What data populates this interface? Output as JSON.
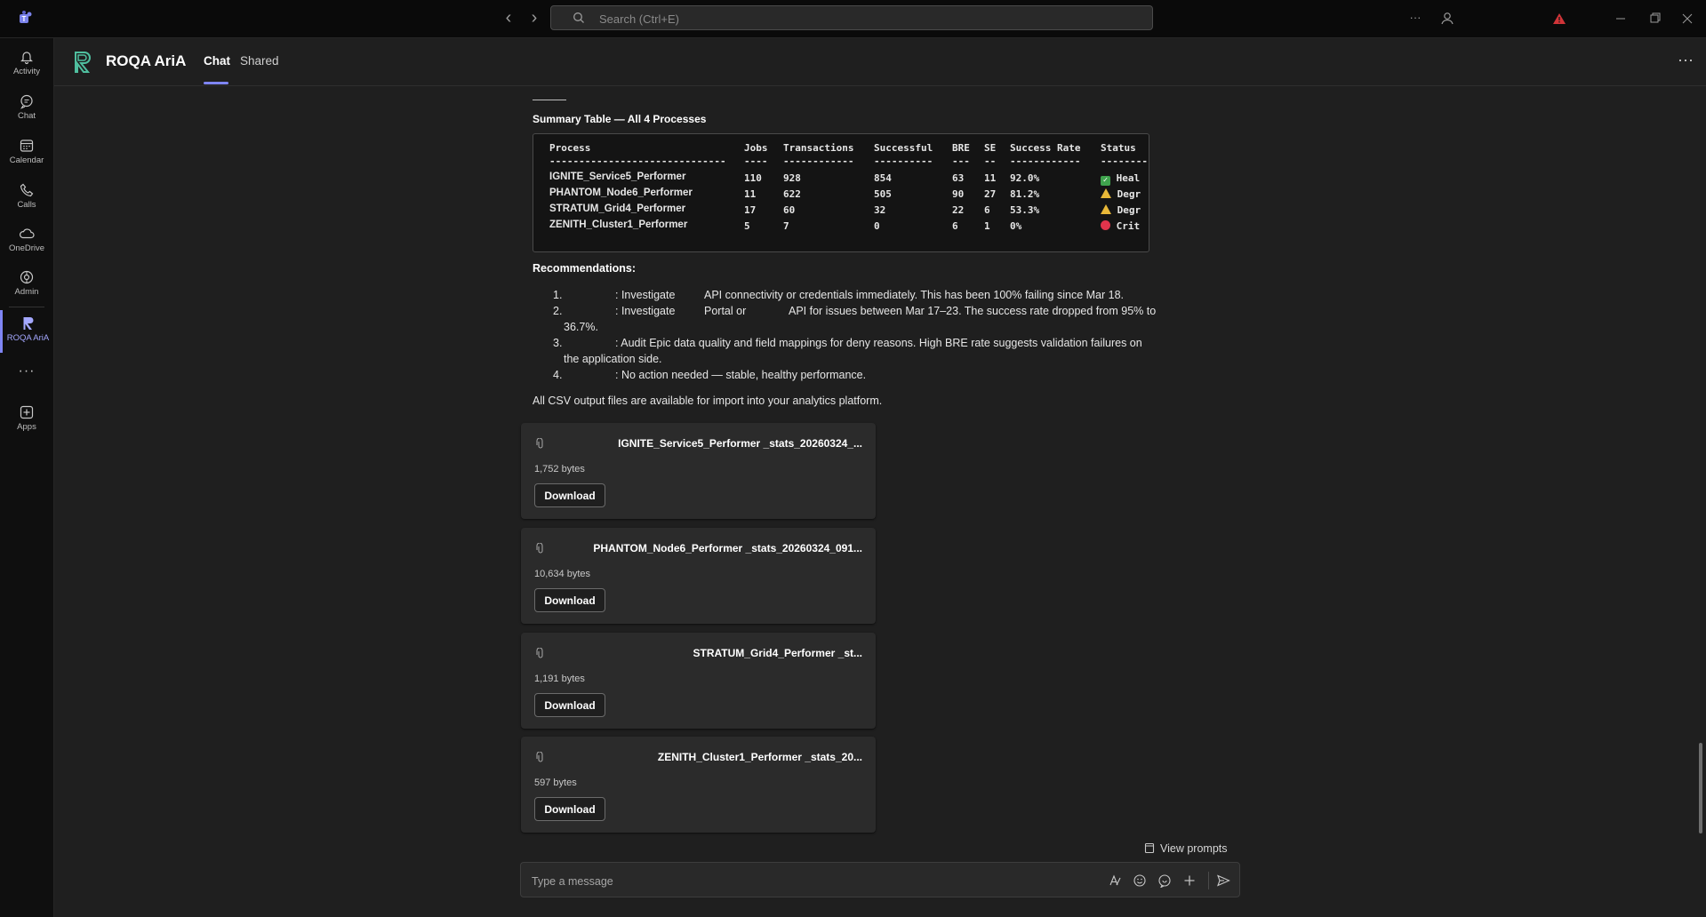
{
  "titlebar": {
    "search_placeholder": "Search (Ctrl+E)",
    "icons": [
      "teams-logo-icon",
      "back-arrow-icon",
      "forward-arrow-icon",
      "search-icon",
      "more-icon",
      "profile-icon",
      "warning-icon",
      "minimize-icon",
      "maximize-icon",
      "close-icon"
    ]
  },
  "rail": {
    "items": [
      {
        "label": "Activity",
        "icon": "bell-icon"
      },
      {
        "label": "Chat",
        "icon": "chat-icon"
      },
      {
        "label": "Calendar",
        "icon": "calendar-icon"
      },
      {
        "label": "Calls",
        "icon": "phone-icon"
      },
      {
        "label": "OneDrive",
        "icon": "cloud-icon"
      },
      {
        "label": "Admin",
        "icon": "admin-icon"
      },
      {
        "label": "ROQA AriA",
        "icon": "roqa-icon",
        "active": true
      },
      {
        "label": "Apps",
        "icon": "add-app-icon"
      }
    ],
    "accent": "#7f85f5"
  },
  "header": {
    "app_name": "ROQA AriA",
    "tabs": [
      {
        "label": "Chat",
        "active": true
      },
      {
        "label": "Shared",
        "active": false
      }
    ]
  },
  "message": {
    "summary_title": "Summary Table — All 4 Processes",
    "table": {
      "headers": [
        "Process",
        "Jobs",
        "Transactions",
        "Successful",
        "BRE",
        "SE",
        "Success Rate",
        "Status"
      ],
      "separators": [
        "------------------------------",
        "----",
        "------------",
        "----------",
        "---",
        "--",
        "------------",
        "--------"
      ],
      "rows": [
        {
          "process": "IGNITE_Service5_Performer",
          "jobs": "110",
          "transactions": "928",
          "successful": "854",
          "bre": "63",
          "se": "11",
          "rate": "92.0%",
          "status": "Heal",
          "status_icon": "check-icon"
        },
        {
          "process": "PHANTOM_Node6_Performer",
          "jobs": "11",
          "transactions": "622",
          "successful": "505",
          "bre": "90",
          "se": "27",
          "rate": "81.2%",
          "status": "Degr",
          "status_icon": "warning-icon"
        },
        {
          "process": "STRATUM_Grid4_Performer",
          "jobs": "17",
          "transactions": "60",
          "successful": "32",
          "bre": "22",
          "se": "6",
          "rate": "53.3%",
          "status": "Degr",
          "status_icon": "warning-icon"
        },
        {
          "process": "ZENITH_Cluster1_Performer",
          "jobs": "5",
          "transactions": "7",
          "successful": "0",
          "bre": "6",
          "se": "1",
          "rate": "0%",
          "status": "Crit",
          "status_icon": "critical-icon"
        }
      ]
    },
    "recommendations_title": "Recommendations:",
    "recommendations": [
      {
        "num": "1.",
        "line1a": ": Investigate",
        "line1b": "API connectivity or credentials immediately. This has been 100% failing since Mar 18.",
        "line2": ""
      },
      {
        "num": "2.",
        "line1a": ": Investigate",
        "line1b": "Portal or",
        "line1c": "API for issues between Mar 17–23. The success rate dropped from 95% to",
        "line2": "36.7%."
      },
      {
        "num": "3.",
        "line1a": ": Audit Epic data quality and field mappings for deny reasons. High BRE rate suggests validation failures on",
        "line2": "the application side."
      },
      {
        "num": "4.",
        "line1a": ": No action needed — stable, healthy performance.",
        "line2": ""
      }
    ],
    "csv_note": "All CSV output files are available for import into your analytics platform.",
    "files": [
      {
        "name": "IGNITE_Service5_Performer _stats_20260324_...",
        "size": "1,752 bytes",
        "button": "Download"
      },
      {
        "name": "PHANTOM_Node6_Performer _stats_20260324_091...",
        "size": "10,634 bytes",
        "button": "Download"
      },
      {
        "name": "STRATUM_Grid4_Performer _st...",
        "size": "1,191 bytes",
        "button": "Download"
      },
      {
        "name": "ZENITH_Cluster1_Performer _stats_20...",
        "size": "597 bytes",
        "button": "Download"
      }
    ]
  },
  "composer": {
    "view_prompts": "View prompts",
    "placeholder": "Type a message",
    "icons": [
      "format-icon",
      "emoji-icon",
      "sticker-icon",
      "attach-plus-icon",
      "send-icon"
    ]
  },
  "colors": {
    "background": "#1f1f1f",
    "titlebar": "#0a0a0a",
    "card": "#2b2b2b",
    "accent": "#7f85f5",
    "healthy": "#3fa34d",
    "degraded": "#e8b838",
    "critical": "#e0344c"
  }
}
